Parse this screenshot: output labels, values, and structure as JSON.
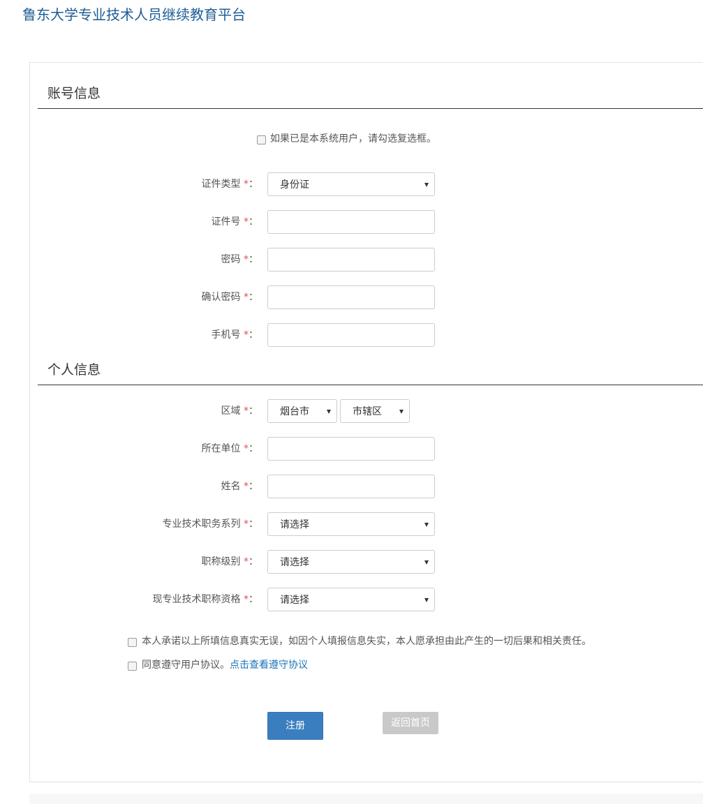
{
  "header": {
    "title": "鲁东大学专业技术人员继续教育平台"
  },
  "account_section": {
    "title": "账号信息",
    "existing_user_checkbox": {
      "checked": false,
      "label": "如果已是本系统用户，请勾选复选框。"
    },
    "fields": [
      {
        "label": "证件类型",
        "type": "select",
        "value": "身份证"
      },
      {
        "label": "证件号",
        "type": "text",
        "value": ""
      },
      {
        "label": "密码",
        "type": "password",
        "value": ""
      },
      {
        "label": "确认密码",
        "type": "password",
        "value": ""
      },
      {
        "label": "手机号",
        "type": "text",
        "value": ""
      }
    ]
  },
  "personal_section": {
    "title": "个人信息",
    "region": {
      "label": "区域",
      "city": "烟台市",
      "district": "市辖区"
    },
    "fields": [
      {
        "label": "所在单位",
        "type": "text",
        "value": ""
      },
      {
        "label": "姓名",
        "type": "text",
        "value": ""
      },
      {
        "label": "专业技术职务系列",
        "type": "select",
        "value": "请选择"
      },
      {
        "label": "职称级别",
        "type": "select",
        "value": "请选择"
      },
      {
        "label": "现专业技术职称资格",
        "type": "select",
        "value": "请选择"
      }
    ]
  },
  "required_marker": "*",
  "label_suffix": "：",
  "agreements": {
    "truthfulness": {
      "checked": false,
      "label": "本人承诺以上所填信息真实无误，如因个人填报信息失实，本人愿承担由此产生的一切后果和相关责任。"
    },
    "user_agreement": {
      "checked": false,
      "label": "同意遵守用户协议。",
      "link_text": "点击查看遵守协议"
    }
  },
  "buttons": {
    "register": "注册",
    "back_home": "返回首页"
  },
  "colors": {
    "brand": "#1d5d95",
    "primary_button": "#3b7ec0",
    "disabled_button": "#c9c9c9",
    "required": "#d9534f",
    "link": "#1a73b8"
  }
}
